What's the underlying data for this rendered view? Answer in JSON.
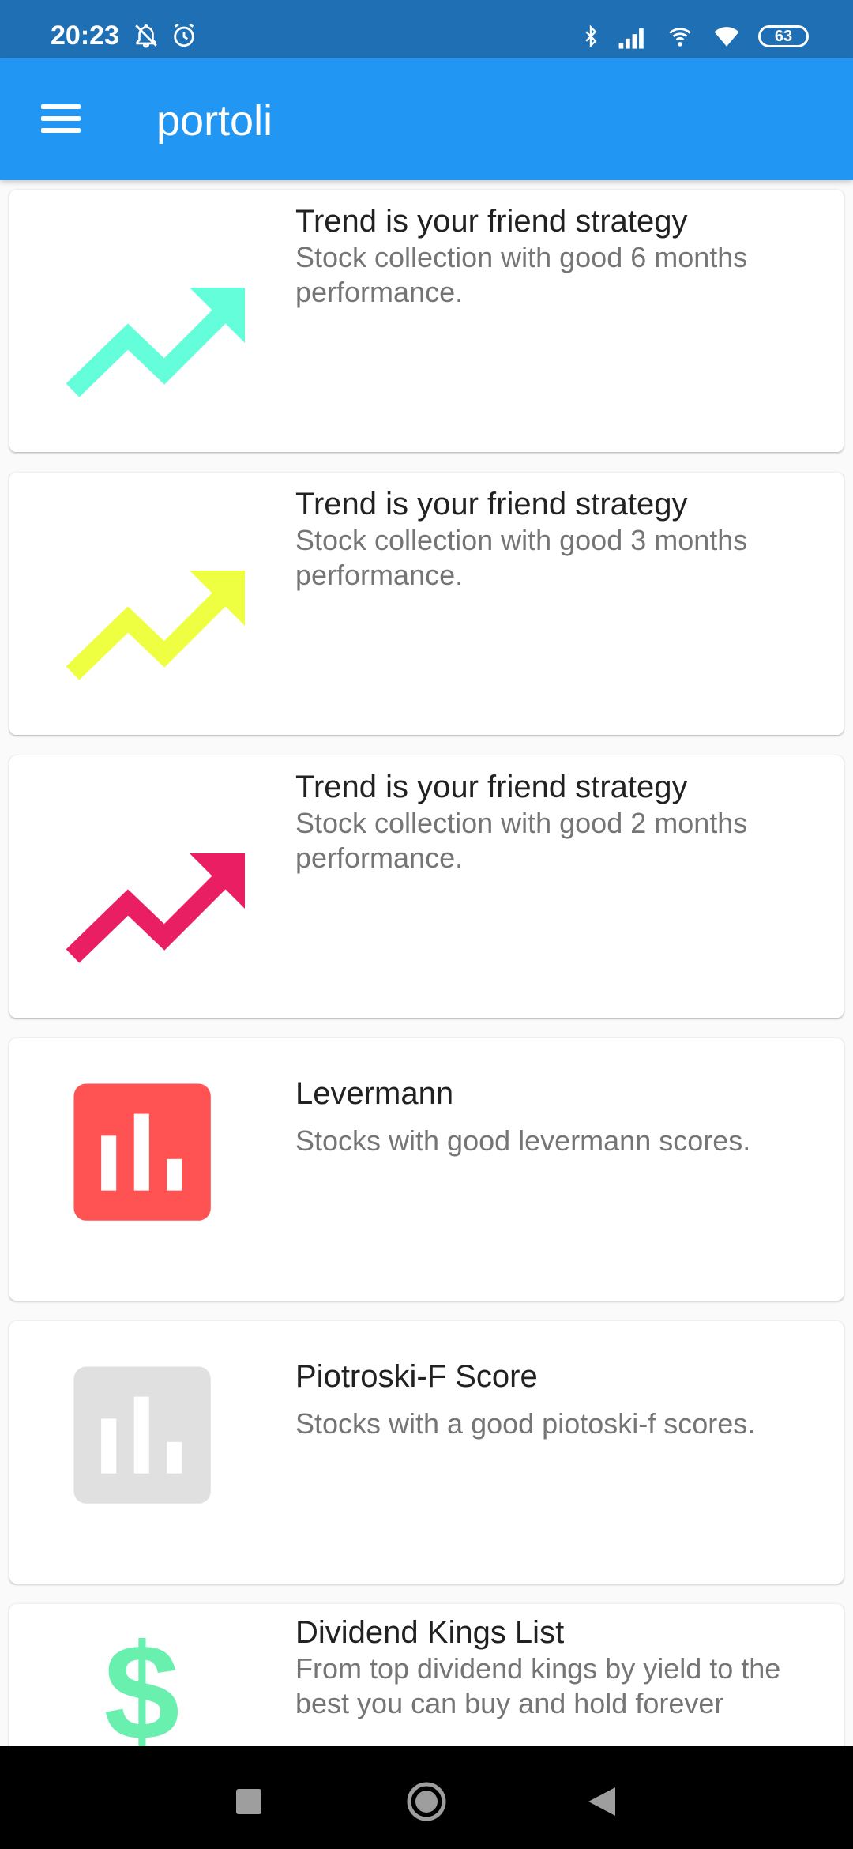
{
  "status_bar": {
    "time": "20:23",
    "battery": "63",
    "icons": [
      "bell-off-icon",
      "alarm-icon",
      "bluetooth-icon",
      "signal-icon",
      "hotspot-icon",
      "wifi-icon",
      "battery-icon"
    ]
  },
  "app_bar": {
    "title": "portoli",
    "menu_icon": "menu-icon"
  },
  "cards": [
    {
      "title": "Trend is your friend strategy",
      "description": "Stock collection with good 6 months performance.",
      "icon": "trending-up-icon",
      "color": "#64ffda"
    },
    {
      "title": "Trend is your friend strategy",
      "description": "Stock collection with good 3 months performance.",
      "icon": "trending-up-icon",
      "color": "#eeff41"
    },
    {
      "title": "Trend is your friend strategy",
      "description": "Stock collection with good 2 months performance.",
      "icon": "trending-up-icon",
      "color": "#e91e63"
    },
    {
      "title": "Levermann",
      "description": "Stocks with good levermann scores.",
      "icon": "bar-chart-icon",
      "color": "#ff5252"
    },
    {
      "title": "Piotroski-F Score",
      "description": "Stocks with a good piotoski-f scores.",
      "icon": "bar-chart-icon",
      "color": "#e0e0e0"
    },
    {
      "title": "Dividend Kings List",
      "description": "From top dividend kings by yield to the best you can buy and hold forever",
      "icon": "dollar-icon",
      "color": "#69f0ae"
    }
  ],
  "nav_bar": {
    "buttons": [
      "recent-apps-icon",
      "home-icon",
      "back-icon"
    ]
  }
}
